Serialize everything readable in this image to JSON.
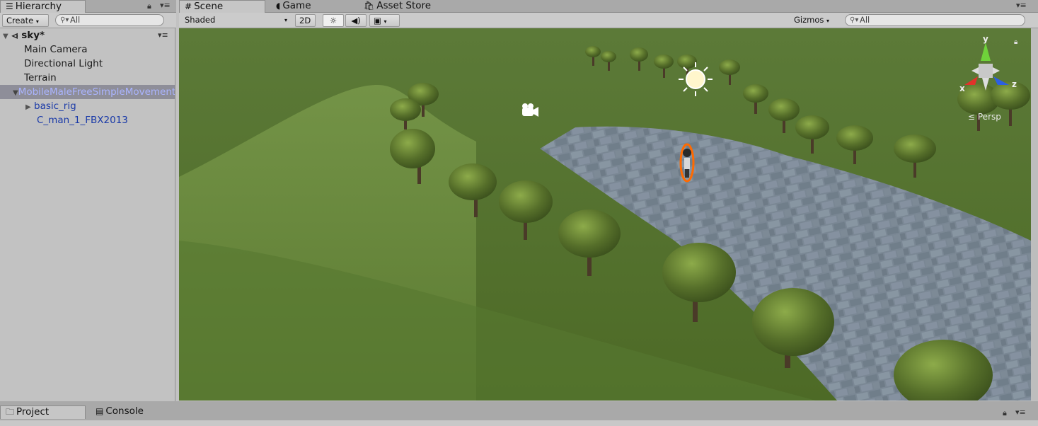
{
  "hierarchy": {
    "tab_label": "Hierarchy",
    "create_label": "Create",
    "search_placeholder": "All",
    "scene_name": "sky*",
    "items": [
      {
        "label": "Main Camera"
      },
      {
        "label": "Directional Light"
      },
      {
        "label": "Terrain"
      },
      {
        "label": "MobileMaleFreeSimpleMovement"
      },
      {
        "label": "basic_rig"
      },
      {
        "label": "C_man_1_FBX2013"
      }
    ]
  },
  "tabs": {
    "scene": "Scene",
    "game": "Game",
    "asset_store": "Asset Store"
  },
  "scene_toolbar": {
    "shading_mode": "Shaded",
    "mode_2d": "2D",
    "gizmos_label": "Gizmos",
    "search_placeholder": "All"
  },
  "gizmo": {
    "y": "y",
    "x": "x",
    "z": "z",
    "projection": "Persp"
  },
  "bottom_tabs": {
    "project": "Project",
    "console": "Console"
  },
  "colors": {
    "selection": "#8e8e99",
    "selected_text": "#aab4ff",
    "prefab_text": "#1a3aa8",
    "grass": "#5a7a2e",
    "stone": "#7e8a95"
  }
}
